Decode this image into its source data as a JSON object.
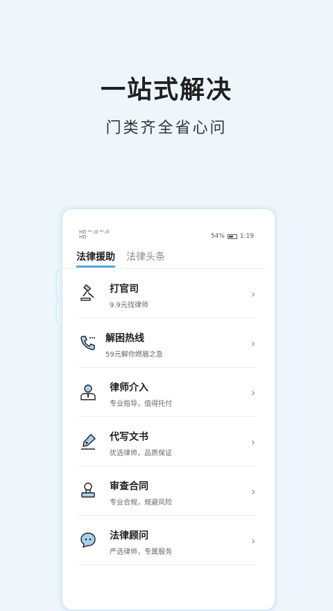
{
  "headline": "一站式解决",
  "subline": "门类齐全省心问",
  "status": {
    "left_top": "HD ⁴ᴳ.ıll ⁴ᴳ.ıll",
    "left_bottom": "HD",
    "battery": "54%",
    "time": "1:19"
  },
  "tabs": [
    {
      "label": "法律援助"
    },
    {
      "label": "法律头条"
    }
  ],
  "services": [
    {
      "title": "打官司",
      "desc": "9.9元找律师",
      "icon": "gavel-icon"
    },
    {
      "title": "解困热线",
      "desc": "59元解你燃眉之急",
      "icon": "phone-call-icon"
    },
    {
      "title": "律师介入",
      "desc": "专业指导，值得托付",
      "icon": "lawyer-person-icon"
    },
    {
      "title": "代写文书",
      "desc": "优选律师，品质保证",
      "icon": "pen-nib-icon"
    },
    {
      "title": "审查合同",
      "desc": "专业合规，规避风险",
      "icon": "stamp-icon"
    },
    {
      "title": "法律顾问",
      "desc": "严选律师，专属服务",
      "icon": "chat-bubble-icon"
    }
  ],
  "chevron": "›",
  "colors": {
    "accent": "#4da3d9",
    "background": "#eef6fb"
  }
}
